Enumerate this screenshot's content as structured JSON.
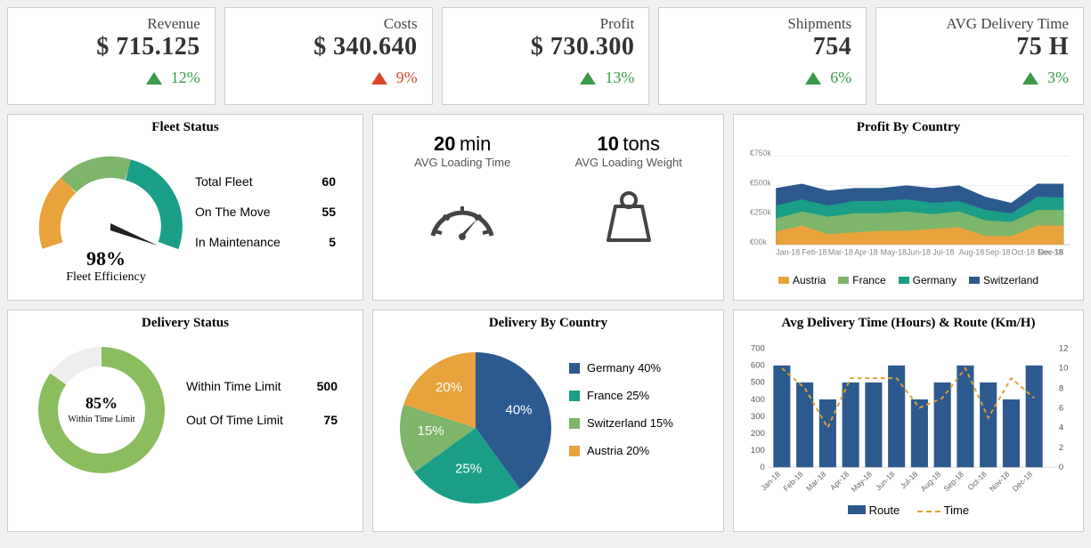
{
  "kpi": [
    {
      "label": "Revenue",
      "value": "$ 715.125",
      "delta": "12%",
      "dir": "up"
    },
    {
      "label": "Costs",
      "value": "$ 340.640",
      "delta": "9%",
      "dir": "up-neg"
    },
    {
      "label": "Profit",
      "value": "$ 730.300",
      "delta": "13%",
      "dir": "up"
    },
    {
      "label": "Shipments",
      "value": "754",
      "delta": "6%",
      "dir": "up"
    },
    {
      "label": "AVG Delivery Time",
      "value": "75 H",
      "delta": "3%",
      "dir": "up"
    }
  ],
  "fleet": {
    "title": "Fleet Status",
    "efficiency_pct": "98%",
    "efficiency_label": "Fleet Efficiency",
    "total_label": "Total Fleet",
    "total": "60",
    "move_label": "On The Move",
    "move": "55",
    "maint_label": "In Maintenance",
    "maint": "5"
  },
  "loading": {
    "time_value": "20",
    "time_unit": "min",
    "time_label": "AVG Loading Time",
    "weight_value": "10",
    "weight_unit": "tons",
    "weight_label": "AVG Loading Weight"
  },
  "profit_country": {
    "title": "Profit By Country",
    "legend": [
      "Austria",
      "France",
      "Germany",
      "Switzerland"
    ],
    "colors": [
      "#e8a33d",
      "#7db56b",
      "#1a9e87",
      "#2d5a8e"
    ]
  },
  "delivery_status": {
    "title": "Delivery Status",
    "pct": "85%",
    "cap": "Within Time Limit",
    "within_label": "Within Time Limit",
    "within": "500",
    "out_label": "Out Of Time Limit",
    "out": "75"
  },
  "delivery_country": {
    "title": "Delivery By Country",
    "slices": [
      {
        "name": "Germany",
        "pct": 40,
        "color": "#2d5a8e"
      },
      {
        "name": "France",
        "pct": 25,
        "color": "#1a9e87"
      },
      {
        "name": "Switzerland",
        "pct": 15,
        "color": "#7db56b"
      },
      {
        "name": "Austria",
        "pct": 20,
        "color": "#e8a33d"
      }
    ]
  },
  "combo": {
    "title": "Avg Delivery Time (Hours) & Route (Km/H)",
    "route_label": "Route",
    "time_label": "Time"
  },
  "chart_data": [
    {
      "type": "area",
      "title": "Profit By Country",
      "categories": [
        "Jan-18",
        "Feb-18",
        "Mar-18",
        "Apr-18",
        "May-18",
        "Jun-18",
        "Jul-18",
        "Aug-18",
        "Sep-18",
        "Oct-18",
        "Nov-18",
        "Dec-18"
      ],
      "series": [
        {
          "name": "Austria",
          "values": [
            90,
            130,
            80,
            90,
            100,
            90,
            110,
            120,
            60,
            70,
            130,
            130
          ]
        },
        {
          "name": "France",
          "values": [
            70,
            60,
            90,
            80,
            80,
            80,
            70,
            80,
            80,
            50,
            90,
            80
          ]
        },
        {
          "name": "Germany",
          "values": [
            80,
            80,
            70,
            100,
            90,
            90,
            80,
            60,
            90,
            100,
            100,
            100
          ]
        },
        {
          "name": "Switzerland",
          "values": [
            130,
            110,
            120,
            100,
            100,
            110,
            110,
            120,
            100,
            80,
            100,
            110
          ]
        }
      ],
      "ylabel": "€",
      "ylim": [
        0,
        750
      ],
      "y_unit": "k"
    },
    {
      "type": "pie",
      "title": "Delivery By Country",
      "categories": [
        "Germany",
        "France",
        "Switzerland",
        "Austria"
      ],
      "values": [
        40,
        25,
        15,
        20
      ]
    },
    {
      "type": "bar+line",
      "title": "Avg Delivery Time (Hours) & Route (Km/H)",
      "categories": [
        "Jan-18",
        "Feb-18",
        "Mar-18",
        "Apr-18",
        "May-18",
        "Jun-18",
        "Jul-18",
        "Aug-18",
        "Sep-18",
        "Oct-18",
        "Nov-18",
        "Dec-18"
      ],
      "series": [
        {
          "name": "Route",
          "type": "bar",
          "axis": "left",
          "values": [
            600,
            500,
            400,
            500,
            500,
            600,
            400,
            500,
            600,
            500,
            400,
            600
          ]
        },
        {
          "name": "Time",
          "type": "line",
          "axis": "right",
          "values": [
            10,
            8,
            4,
            9,
            9,
            9,
            6,
            7,
            10,
            5,
            9,
            7
          ]
        }
      ],
      "ylim_left": [
        0,
        700
      ],
      "ylim_right": [
        0,
        12
      ]
    },
    {
      "type": "gauge",
      "title": "Fleet Efficiency",
      "value": 98,
      "max": 100
    },
    {
      "type": "donut",
      "title": "Within Time Limit",
      "value": 85,
      "max": 100
    }
  ]
}
